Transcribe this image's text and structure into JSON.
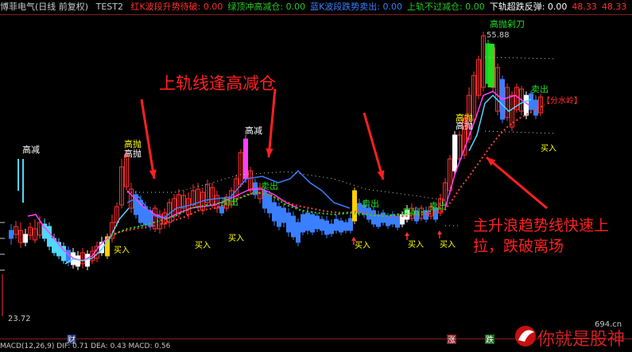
{
  "header": {
    "stock_title": "博菲电气(日线 前复权)",
    "indicator_name": "TEST2",
    "items": [
      {
        "label": "红K波段升势待破:",
        "value": "0.00",
        "color": "#ff3030"
      },
      {
        "label": "绿顶冲高减仓:",
        "value": "0.00",
        "color": "#22cc22"
      },
      {
        "label": "蓝K波段跌势卖出:",
        "value": "0.00",
        "color": "#3a7fff"
      },
      {
        "label": "上轨不过减仓:",
        "value": "0.00",
        "color": "#22cc22"
      },
      {
        "label": "下轨超跌反弹:",
        "value": "0.00",
        "color": "#ffffff"
      },
      {
        "label": "",
        "value": "48.33",
        "color": "#ff3030"
      },
      {
        "label": "",
        "value": "48.33",
        "color": "#ff3030"
      },
      {
        "label": "",
        "value": "48.04",
        "color": "#22cc22"
      },
      {
        "label": "上轨",
        "value": "",
        "color": "#ffff00"
      }
    ]
  },
  "price_labels": {
    "high": "55.88",
    "low": "23.72"
  },
  "annotations": {
    "upper_rail": "上轨线逢高减仓",
    "main_trend_line1": "主升浪趋势线快速上",
    "main_trend_line2": "拉，跌破离场"
  },
  "signals": {
    "gaojian": "高减",
    "gaopao": "高抛",
    "maichu": "卖出",
    "mairu": "买入",
    "fenshuiling": "分水岭",
    "cut_knife": "剁刀"
  },
  "bottom_markers": {
    "cai": "财",
    "zhang": "涨",
    "die": "跌"
  },
  "bottom_bar": "MACD(12,26,9) DIF: 0.71 DEA: 0.43 MACD: 0.56",
  "watermark": {
    "main": "你就是股神",
    "site": "694.cn"
  },
  "colors": {
    "bg": "#000000",
    "up": "#ff3030",
    "down": "#3a7fff",
    "accent": "#ffff00"
  }
}
